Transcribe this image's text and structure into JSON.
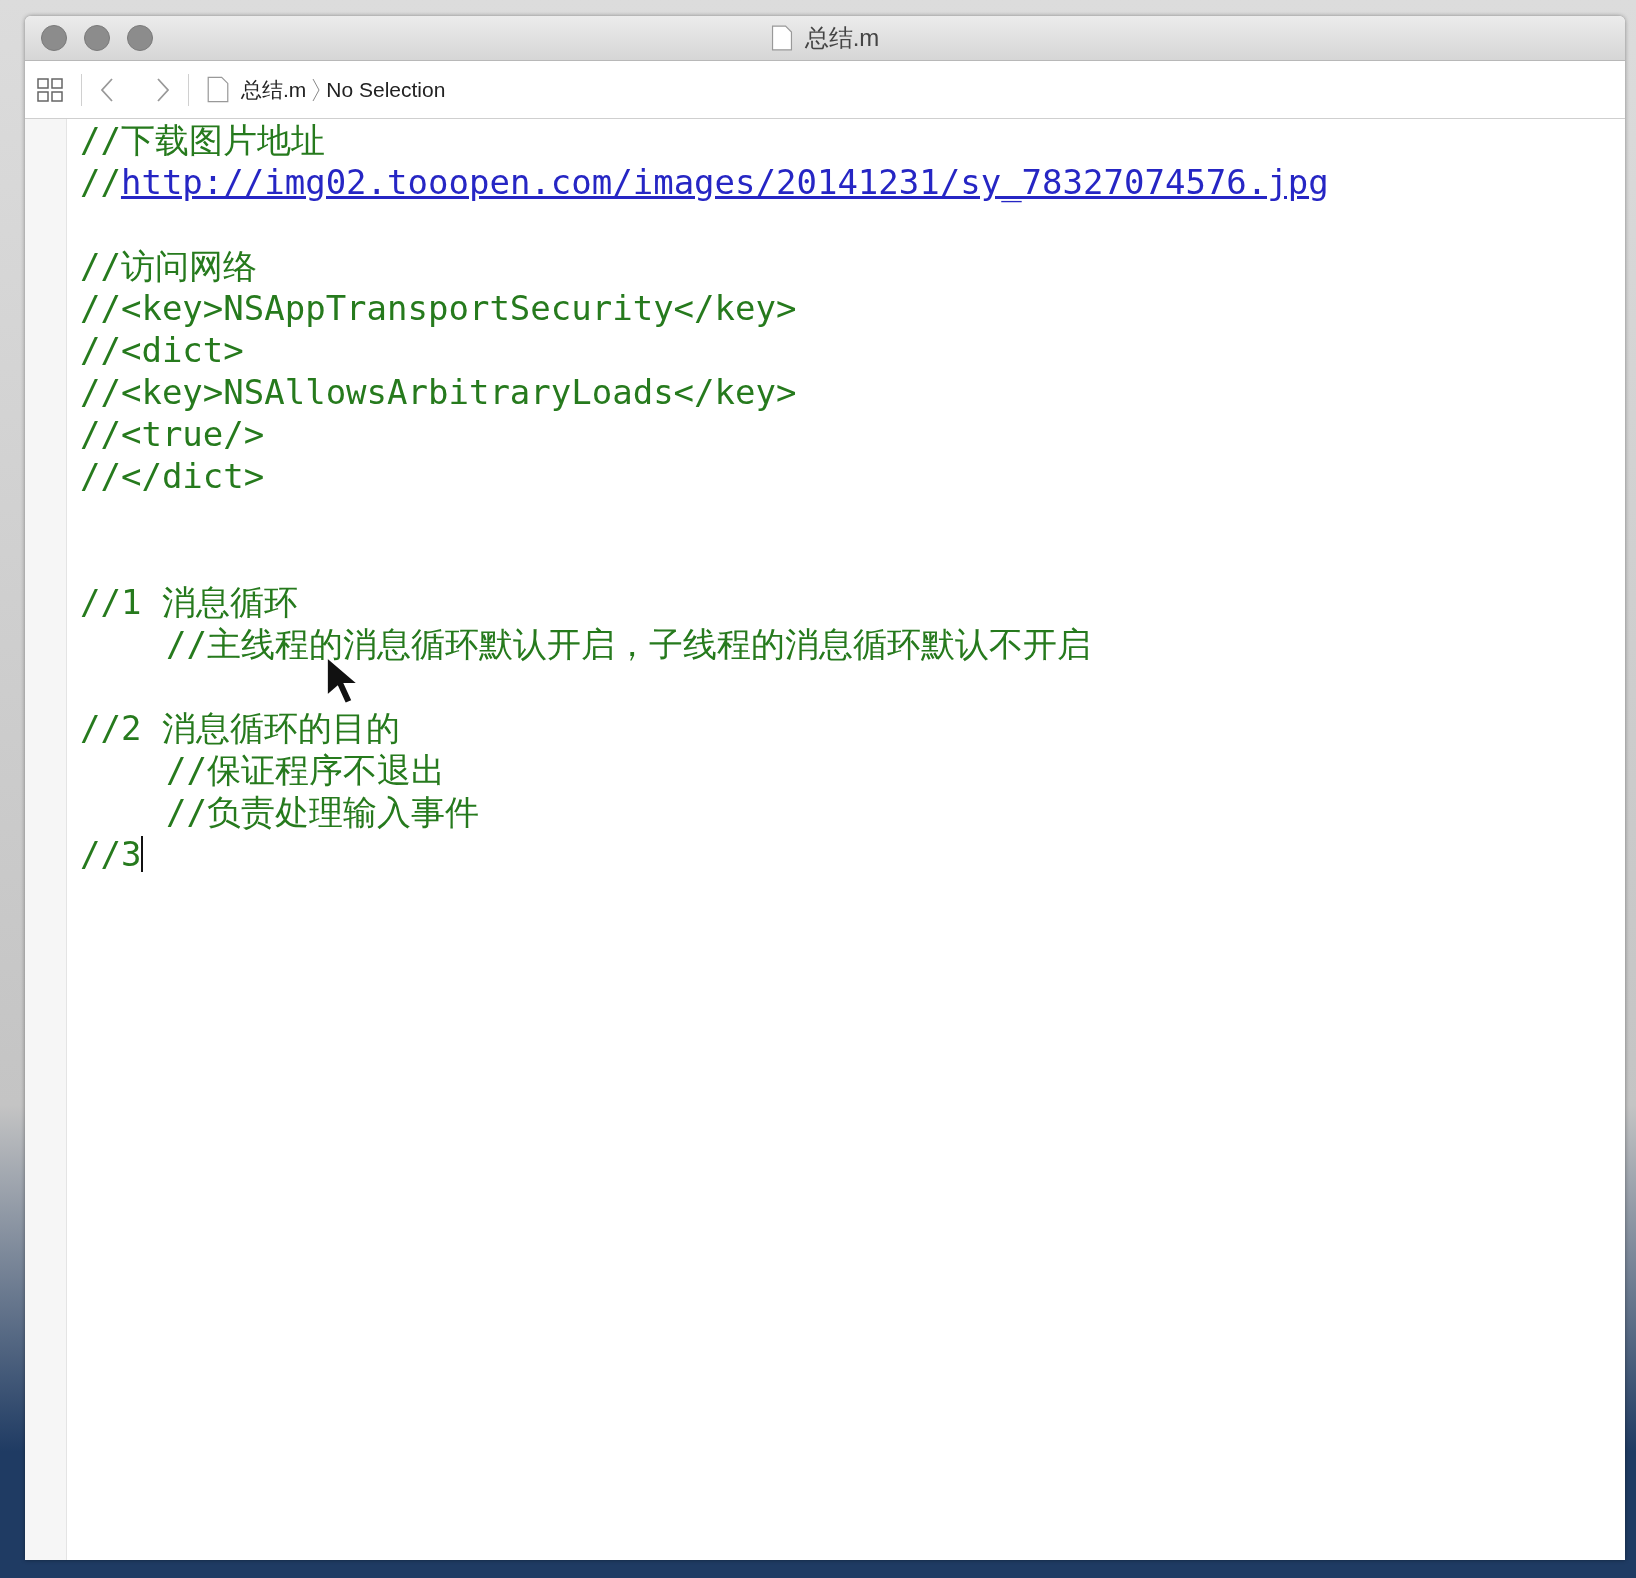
{
  "window": {
    "title": "总结.m"
  },
  "jump_bar": {
    "file": "总结.m",
    "selection": "No Selection"
  },
  "editor": {
    "lines": [
      {
        "kind": "comment",
        "text": "//下载图片地址"
      },
      {
        "kind": "link",
        "prefix": "//",
        "text": "http://img02.tooopen.com/images/20141231/sy_78327074576.jpg"
      },
      {
        "kind": "blank"
      },
      {
        "kind": "comment",
        "text": "//访问网络"
      },
      {
        "kind": "comment",
        "text": "//<key>NSAppTransportSecurity</key>"
      },
      {
        "kind": "comment",
        "text": "//<dict>"
      },
      {
        "kind": "comment",
        "text": "//<key>NSAllowsArbitraryLoads</key>"
      },
      {
        "kind": "comment",
        "text": "//<true/>"
      },
      {
        "kind": "comment",
        "text": "//</dict>"
      },
      {
        "kind": "blank"
      },
      {
        "kind": "blank"
      },
      {
        "kind": "comment",
        "text": "//1 消息循环",
        "children": [
          {
            "kind": "comment",
            "text": "//主线程的消息循环默认开启，子线程的消息循环默认不开启"
          }
        ]
      },
      {
        "kind": "blank"
      },
      {
        "kind": "comment",
        "text": "//2 消息循环的目的",
        "children": [
          {
            "kind": "comment",
            "text": "//保证程序不退出"
          },
          {
            "kind": "comment",
            "text": "//负责处理输入事件"
          }
        ]
      },
      {
        "kind": "comment",
        "text": "//3 ",
        "caret": true
      }
    ]
  }
}
